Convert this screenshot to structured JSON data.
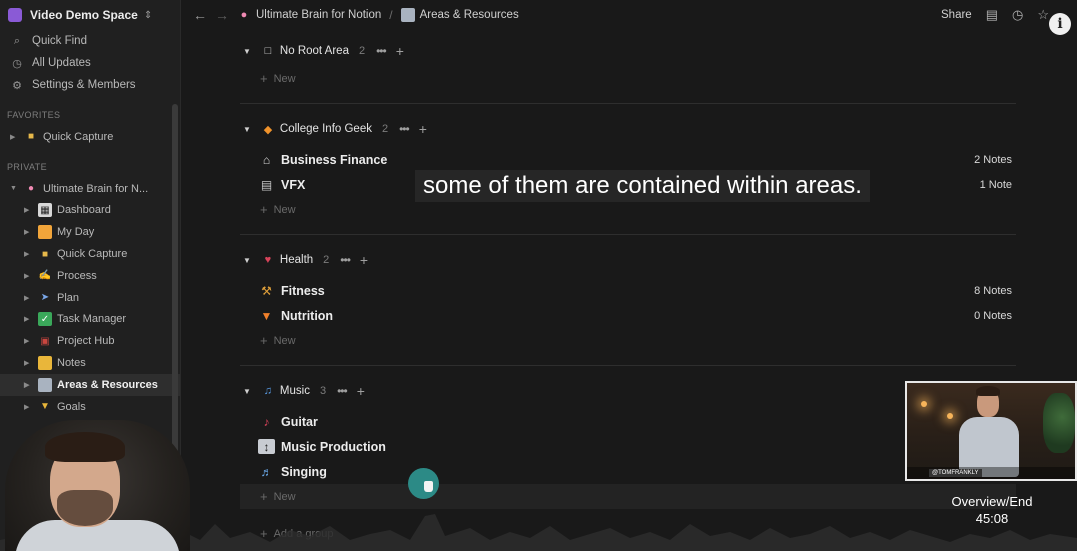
{
  "workspace": {
    "name": "Video Demo Space",
    "caret": "⇕"
  },
  "sidebar": {
    "top_items": [
      {
        "icon": "search-icon",
        "label": "Quick Find"
      },
      {
        "icon": "clock-icon",
        "label": "All Updates"
      },
      {
        "icon": "gear-icon",
        "label": "Settings & Members"
      }
    ],
    "favorites_title": "FAVORITES",
    "favorites": [
      {
        "label": "Quick Capture"
      }
    ],
    "private_title": "PRIVATE",
    "root": {
      "label": "Ultimate Brain for N..."
    },
    "children": [
      {
        "label": "Dashboard"
      },
      {
        "label": "My Day"
      },
      {
        "label": "Quick Capture"
      },
      {
        "label": "Process"
      },
      {
        "label": "Plan"
      },
      {
        "label": "Task Manager"
      },
      {
        "label": "Project Hub"
      },
      {
        "label": "Notes"
      },
      {
        "label": "Areas & Resources"
      },
      {
        "label": "Goals"
      }
    ]
  },
  "topbar": {
    "breadcrumb": [
      "Ultimate Brain for Notion",
      "Areas & Resources"
    ],
    "separator": "/",
    "share_label": "Share"
  },
  "groups": [
    {
      "name": "No Root Area",
      "count": "2",
      "items": [],
      "new_label": "New"
    },
    {
      "name": "College Info Geek",
      "count": "2",
      "items": [
        {
          "name": "Business Finance",
          "count": "2 Notes"
        },
        {
          "name": "VFX",
          "count": "1 Note"
        }
      ],
      "new_label": "New"
    },
    {
      "name": "Health",
      "count": "2",
      "items": [
        {
          "name": "Fitness",
          "count": "8 Notes"
        },
        {
          "name": "Nutrition",
          "count": "0 Notes"
        }
      ],
      "new_label": "New"
    },
    {
      "name": "Music",
      "count": "3",
      "items": [
        {
          "name": "Guitar",
          "count": ""
        },
        {
          "name": "Music Production",
          "count": ""
        },
        {
          "name": "Singing",
          "count": ""
        }
      ],
      "new_label": "New"
    }
  ],
  "add_group_label": "Add a group",
  "caption": "some of them are contained within areas.",
  "video": {
    "chapter": "Overview/End",
    "time": "45:08",
    "handle": "@TOMFRANKLY"
  },
  "colors": {
    "background": "#191919",
    "sidebar": "#202020",
    "cursor_ring": "#2c8a86"
  }
}
